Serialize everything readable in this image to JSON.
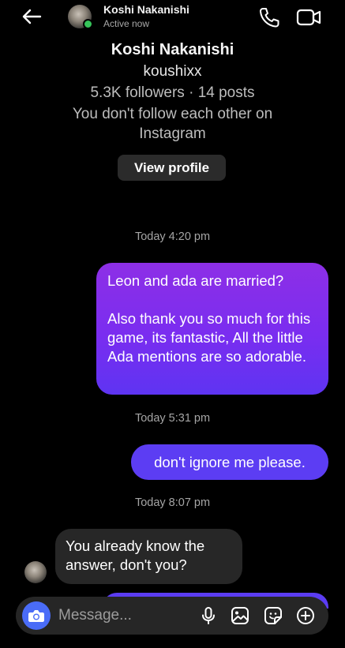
{
  "header": {
    "name": "Koshi Nakanishi",
    "status": "Active now",
    "icons": {
      "back": "back-arrow-icon",
      "call": "phone-icon",
      "video": "video-camera-icon"
    }
  },
  "profile": {
    "name": "Koshi Nakanishi",
    "username": "koushixx",
    "stats": "5.3K followers · 14 posts",
    "follow_note": "You don't follow each other on Instagram",
    "view_profile_label": "View profile"
  },
  "messages": [
    {
      "timestamp": "Today 4:20 pm",
      "direction": "outgoing",
      "line1": "Leon and ada are married?",
      "line2": "Also thank you so much for this game, its fantastic, All the little Ada mentions are so adorable."
    },
    {
      "timestamp": "Today 5:31 pm",
      "direction": "outgoing",
      "text": "don't ignore me please."
    },
    {
      "timestamp": "Today 8:07 pm",
      "direction": "incoming",
      "text": "You already know the answer, don't you?"
    }
  ],
  "composer": {
    "placeholder": "Message...",
    "icons": [
      "camera-icon",
      "microphone-icon",
      "gallery-icon",
      "sticker-icon",
      "plus-icon"
    ]
  },
  "colors": {
    "background": "#000000",
    "outgoing_bubble_top": "#8d2fe6",
    "outgoing_bubble_bottom": "#5e34f2",
    "incoming_bubble": "#272727",
    "camera_button": "#4a6cf7",
    "online_dot": "#36c45a"
  }
}
